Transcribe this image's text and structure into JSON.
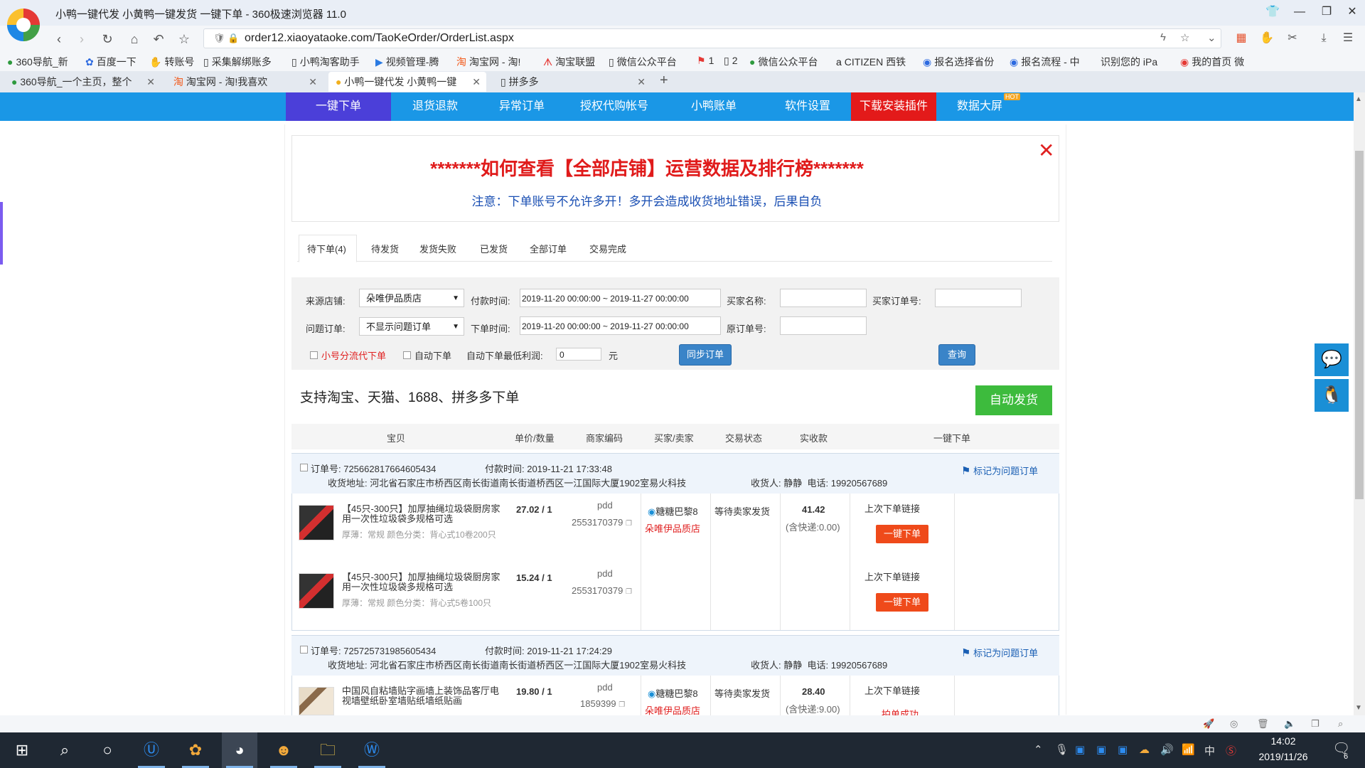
{
  "window": {
    "title": "小鸭一键代发 小黄鸭一键发货 一键下单 - 360极速浏览器 11.0"
  },
  "addressbar": {
    "url": "order12.xiaoyataoke.com/TaoKeOrder/OrderList.aspx"
  },
  "bookmarks": [
    {
      "label": "360导航_新",
      "icon": "360-icon"
    },
    {
      "label": "百度一下",
      "icon": "baidu-icon"
    },
    {
      "label": "转账号",
      "icon": "fold-icon"
    },
    {
      "label": "采集解绑账多",
      "icon": "page-icon"
    },
    {
      "label": "小鸭淘客助手",
      "icon": "page-icon"
    },
    {
      "label": "视频管理-腾",
      "icon": "video-icon"
    },
    {
      "label": "淘宝网 - 淘!",
      "icon": "taobao-icon"
    },
    {
      "label": "淘宝联盟",
      "icon": "alimama-icon"
    },
    {
      "label": "微信公众平台",
      "icon": "page-icon"
    },
    {
      "label": "1",
      "icon": "flag-icon"
    },
    {
      "label": "2",
      "icon": "page-icon"
    },
    {
      "label": "微信公众平台",
      "icon": "wechat-icon"
    },
    {
      "label": "CITIZEN 西铁",
      "icon": "amazon-icon"
    },
    {
      "label": "报名选择省份",
      "icon": "globe-icon"
    },
    {
      "label": "报名流程 - 中",
      "icon": "globe-icon"
    },
    {
      "label": "识别您的 iPa",
      "icon": "apple-icon"
    },
    {
      "label": "我的首页 微",
      "icon": "weibo-icon"
    }
  ],
  "tabs": [
    {
      "label": "360导航_一个主页，整个"
    },
    {
      "label": "淘宝网 - 淘!我喜欢"
    },
    {
      "label": "小鸭一键代发 小黄鸭一键"
    },
    {
      "label": "拼多多"
    }
  ],
  "sitenav": {
    "items": [
      "一键下单",
      "退货退款",
      "异常订单",
      "授权代购帐号",
      "小鸭账单",
      "软件设置",
      "下载安装插件",
      "数据大屏"
    ],
    "badge": "HOT",
    "active_color": "#4b3fd9",
    "bar_color": "#1a97e6",
    "download_color": "#e31a1a"
  },
  "notice": {
    "title": "*******如何查看【全部店铺】运营数据及排行榜*******",
    "subtitle": "注意：下单账号不允许多开！多开会造成收货地址错误，后果自负"
  },
  "order_tabs": [
    "待下单(4)",
    "待发货",
    "发货失败",
    "已发货",
    "全部订单",
    "交易完成"
  ],
  "filters": {
    "source_shop_label": "来源店铺:",
    "source_shop_value": "朵唯伊品质店",
    "pay_time_label": "付款时间:",
    "pay_time_value": "2019-11-20 00:00:00 ~ 2019-11-27 00:00:00",
    "buyer_name_label": "买家名称:",
    "buyer_order_label": "买家订单号:",
    "problem_label": "问题订单:",
    "problem_value": "不显示问题订单",
    "order_time_label": "下单时间:",
    "order_time_value": "2019-11-20 00:00:00 ~ 2019-11-27 00:00:00",
    "orig_order_label": "原订单号:",
    "split_label": "小号分流代下单",
    "auto_order_label": "自动下单",
    "min_profit_label": "自动下单最低利润:",
    "min_profit_value": "0",
    "unit": "元",
    "sync_button": "同步订单",
    "query_button": "查询"
  },
  "support_text": "支持淘宝、天猫、1688、拼多多下单",
  "auto_ship_button": "自动发货",
  "table_headers": [
    "宝贝",
    "单价/数量",
    "商家编码",
    "买家/卖家",
    "交易状态",
    "实收款",
    "一键下单"
  ],
  "orders": [
    {
      "order_no": "订单号: 725662817664605434",
      "pay_time": "付款时间: 2019-11-21 17:33:48",
      "address": "收货地址: 河北省石家庄市桥西区南长街道南长街道桥西区一江国际大厦1902室易火科技",
      "receiver_label": "收货人:",
      "receiver": "静静",
      "phone": "电话: 19920567689",
      "flag_label": "标记为问题订单",
      "buyer": "糖糖巴黎8",
      "seller": "朵唯伊品质店",
      "status": "等待卖家发货",
      "amount": "41.42",
      "shipping": "(含快递:0.00)",
      "items": [
        {
          "title": "【45只-300只】加厚抽绳垃圾袋厨房家用一次性垃圾袋多规格可选",
          "spec": "厚薄：常规  颜色分类：背心式10卷200只",
          "price_qty": "27.02 / 1",
          "code_src": "pdd",
          "code": "2553170379",
          "last_link": "上次下单链接",
          "order_btn": "一键下单"
        },
        {
          "title": "【45只-300只】加厚抽绳垃圾袋厨房家用一次性垃圾袋多规格可选",
          "spec": "厚薄：常规  颜色分类：背心式5卷100只",
          "price_qty": "15.24 / 1",
          "code_src": "pdd",
          "code": "2553170379",
          "last_link": "上次下单链接",
          "order_btn": "一键下单"
        }
      ]
    },
    {
      "order_no": "订单号: 725725731985605434",
      "pay_time": "付款时间: 2019-11-21 17:24:29",
      "address": "收货地址: 河北省石家庄市桥西区南长街道南长街道桥西区一江国际大厦1902室易火科技",
      "receiver_label": "收货人:",
      "receiver": "静静",
      "phone": "电话: 19920567689",
      "flag_label": "标记为问题订单",
      "buyer": "糖糖巴黎8",
      "seller": "朵唯伊品质店",
      "status": "等待卖家发货",
      "amount": "28.40",
      "shipping": "(含快递:9.00)",
      "items": [
        {
          "title": "中国风自粘墙贴字画墙上装饰品客厅电视墙壁纸卧室墙贴纸墙纸贴画",
          "price_qty": "19.80 / 1",
          "code_src": "pdd",
          "code": "1859399",
          "last_link": "上次下单链接",
          "result": "拍单成功"
        }
      ]
    }
  ],
  "taskbar": {
    "time": "14:02",
    "date": "2019/11/26",
    "ime": "中",
    "notifications": "6"
  }
}
